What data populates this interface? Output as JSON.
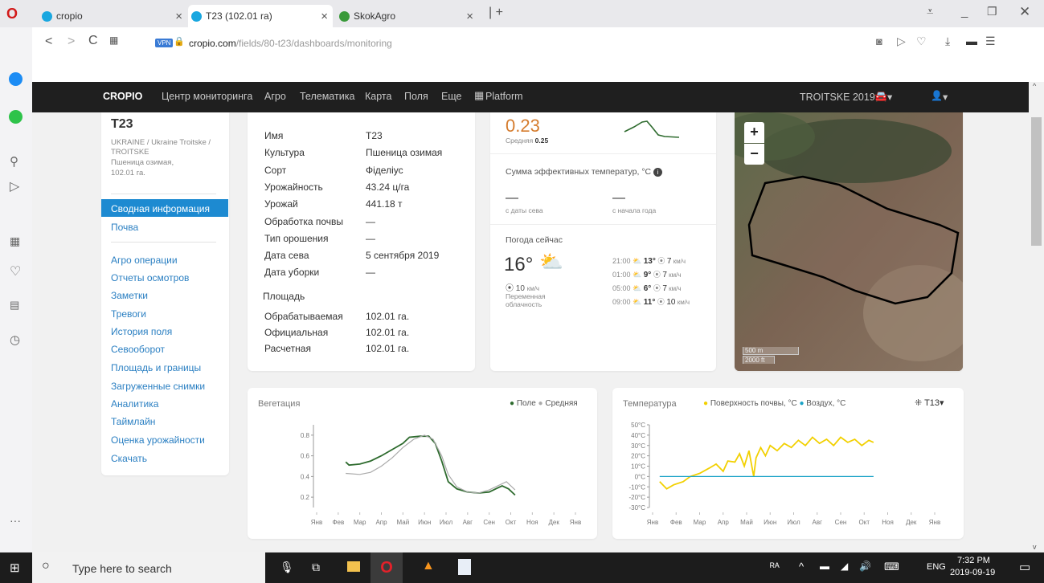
{
  "browser": {
    "tabs": [
      {
        "label": "cropio"
      },
      {
        "label": "T23 (102.01 ra)"
      },
      {
        "label": "SkokAgro"
      }
    ],
    "vpn": "VPN",
    "url_host": "cropio.com",
    "url_path": "/fields/80-t23/dashboards/monitoring"
  },
  "nav": {
    "logo": "CROPIO",
    "items": [
      "Центр мониторинга",
      "Агро",
      "Телематика",
      "Карта",
      "Поля",
      "Еще",
      "Platform"
    ],
    "season": "TROITSKE 2019 ▾",
    "car": "▾",
    "user": "▾"
  },
  "field": {
    "name": "T23",
    "path": "UKRAINE / Ukraine Troitske / TROITSKE",
    "crop_line": "Пшеница озимая,",
    "area_line": "102.01 га."
  },
  "menu": {
    "active": "Сводная информация",
    "soil": "Почва",
    "items": [
      "Агро операции",
      "Отчеты осмотров",
      "Заметки",
      "Тревоги",
      "История поля",
      "Севооборот",
      "Площадь и границы",
      "Загруженные снимки",
      "Аналитика",
      "Таймлайн",
      "Оценка урожайности",
      "Скачать"
    ]
  },
  "info": {
    "rows": [
      [
        "Имя",
        "T23"
      ],
      [
        "Культура",
        "Пшеница озимая"
      ],
      [
        "Сорт",
        "Фіделіус"
      ],
      [
        "Урожайность",
        "43.24 ц/га"
      ],
      [
        "Урожай",
        "441.18 т"
      ],
      [
        "Обработка почвы",
        "—"
      ],
      [
        "Тип орошения",
        "—"
      ],
      [
        "Дата сева",
        "5 сентября 2019"
      ],
      [
        "Дата уборки",
        "—"
      ]
    ],
    "area_title": "Площадь",
    "area_rows": [
      [
        "Обрабатываемая",
        "102.01 га."
      ],
      [
        "Официальная",
        "102.01 га."
      ],
      [
        "Расчетная",
        "102.01 га."
      ]
    ]
  },
  "ndvi": {
    "value": "0.23",
    "avg_label": "Средняя",
    "avg": "0.25"
  },
  "gdd": {
    "title": "Сумма эффективных температур, °С",
    "since_sow_val": "—",
    "since_sow": "с даты сева",
    "since_year_val": "—",
    "since_year": "с начала года"
  },
  "weather": {
    "title": "Погода сейчас",
    "temp": "16°",
    "wind": "10",
    "wind_unit": "км/ч",
    "desc1": "Переменная",
    "desc2": "облачность",
    "forecast": [
      {
        "time": "21:00",
        "t": "13°",
        "w": "7",
        "u": "км/ч"
      },
      {
        "time": "01:00",
        "t": "9°",
        "w": "7",
        "u": "км/ч"
      },
      {
        "time": "05:00",
        "t": "6°",
        "w": "7",
        "u": "км/ч"
      },
      {
        "time": "09:00",
        "t": "11°",
        "w": "10",
        "u": "км/ч"
      }
    ]
  },
  "map": {
    "zoom_in": "+",
    "zoom_out": "−",
    "scale_m": "500 m",
    "scale_ft": "2000 ft"
  },
  "veg_chart": {
    "title": "Вегетация",
    "legend_field": "Поле",
    "legend_avg": "Средняя"
  },
  "temp_chart": {
    "title": "Температура",
    "legend_soil": "Поверхность почвы, °С",
    "legend_air": "Воздух, °С",
    "station": "T13"
  },
  "chart_data": [
    {
      "type": "line",
      "title": "Вегетация",
      "categories": [
        "Янв",
        "Фев",
        "Мар",
        "Апр",
        "Май",
        "Июн",
        "Июл",
        "Авг",
        "Сен",
        "Окт",
        "Ноя",
        "Дек",
        "Янв"
      ],
      "ylim": [
        0.1,
        0.9
      ],
      "yticks": [
        0.2,
        0.4,
        0.6,
        0.8
      ],
      "series": [
        {
          "name": "Поле",
          "color": "#2e6b2e",
          "points": [
            [
              1.35,
              0.54
            ],
            [
              1.5,
              0.51
            ],
            [
              2,
              0.52
            ],
            [
              2.5,
              0.55
            ],
            [
              3,
              0.6
            ],
            [
              3.5,
              0.66
            ],
            [
              4,
              0.72
            ],
            [
              4.3,
              0.78
            ],
            [
              4.8,
              0.79
            ],
            [
              5.2,
              0.79
            ],
            [
              5.5,
              0.72
            ],
            [
              5.8,
              0.55
            ],
            [
              6.1,
              0.35
            ],
            [
              6.5,
              0.28
            ],
            [
              7,
              0.25
            ],
            [
              7.5,
              0.24
            ],
            [
              8,
              0.25
            ],
            [
              8.3,
              0.28
            ],
            [
              8.6,
              0.31
            ],
            [
              8.9,
              0.28
            ],
            [
              9.2,
              0.22
            ]
          ]
        },
        {
          "name": "Средняя",
          "color": "#aaaaaa",
          "points": [
            [
              1.35,
              0.43
            ],
            [
              2,
              0.42
            ],
            [
              2.5,
              0.44
            ],
            [
              3,
              0.5
            ],
            [
              3.5,
              0.58
            ],
            [
              4,
              0.68
            ],
            [
              4.5,
              0.76
            ],
            [
              5,
              0.8
            ],
            [
              5.4,
              0.76
            ],
            [
              5.8,
              0.6
            ],
            [
              6.1,
              0.42
            ],
            [
              6.5,
              0.3
            ],
            [
              7,
              0.25
            ],
            [
              7.5,
              0.24
            ],
            [
              8,
              0.27
            ],
            [
              8.5,
              0.32
            ],
            [
              8.8,
              0.35
            ],
            [
              9.2,
              0.27
            ]
          ]
        }
      ]
    },
    {
      "type": "line",
      "title": "Температура",
      "categories": [
        "Янв",
        "Фев",
        "Мар",
        "Апр",
        "Май",
        "Июн",
        "Июл",
        "Авг",
        "Сен",
        "Окт",
        "Ноя",
        "Дек",
        "Янв"
      ],
      "ylim": [
        -30,
        50
      ],
      "yticks": [
        -30,
        -20,
        -10,
        0,
        10,
        20,
        30,
        40,
        50
      ],
      "series": [
        {
          "name": "Поверхность почвы, °С",
          "color": "#f2d000",
          "points": [
            [
              0.3,
              -5
            ],
            [
              0.6,
              -12
            ],
            [
              0.9,
              -8
            ],
            [
              1.3,
              -5
            ],
            [
              1.6,
              0
            ],
            [
              2,
              3
            ],
            [
              2.4,
              8
            ],
            [
              2.7,
              12
            ],
            [
              3,
              5
            ],
            [
              3.2,
              15
            ],
            [
              3.5,
              14
            ],
            [
              3.7,
              22
            ],
            [
              3.9,
              10
            ],
            [
              4.1,
              25
            ],
            [
              4.3,
              0
            ],
            [
              4.4,
              18
            ],
            [
              4.6,
              28
            ],
            [
              4.8,
              20
            ],
            [
              5,
              30
            ],
            [
              5.3,
              25
            ],
            [
              5.6,
              32
            ],
            [
              5.9,
              28
            ],
            [
              6.2,
              35
            ],
            [
              6.5,
              30
            ],
            [
              6.8,
              38
            ],
            [
              7.1,
              32
            ],
            [
              7.4,
              36
            ],
            [
              7.7,
              30
            ],
            [
              8,
              38
            ],
            [
              8.3,
              33
            ],
            [
              8.6,
              36
            ],
            [
              8.9,
              30
            ],
            [
              9.2,
              35
            ],
            [
              9.4,
              33
            ]
          ]
        },
        {
          "name": "Воздух, °С",
          "color": "#1aa3c7",
          "points": [
            [
              0.3,
              0
            ],
            [
              9.4,
              0
            ]
          ]
        }
      ]
    }
  ],
  "taskbar": {
    "search": "Type here to search",
    "lang": "ENG",
    "time": "7:32 PM",
    "date": "2019-09-19"
  }
}
